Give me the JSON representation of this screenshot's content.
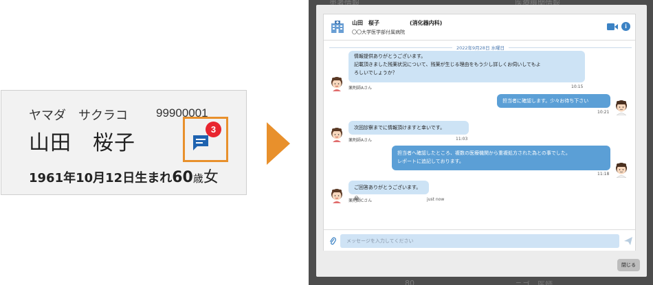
{
  "patient_card": {
    "kana": "ヤマダ　サクラコ",
    "patient_id": "99900001",
    "name": "山田　桜子",
    "dob": "1961年10月12日生まれ",
    "age": "60",
    "age_unit": "歳",
    "sex": "女",
    "unread_count": "3",
    "accent_color": "#e8902c",
    "badge_color": "#e8252f"
  },
  "background": {
    "tab_left": "患者情報",
    "tab_right": "医療機関情報",
    "footer_left": "80",
    "footer_right": "ニゴ　医師"
  },
  "chat": {
    "header": {
      "patient": "山田　桜子",
      "department": "(消化器内科)",
      "hospital": "〇〇大学医学部付属病院"
    },
    "date_separator": "2022年9月28日 水曜日",
    "messages": [
      {
        "dir": "in",
        "lines": [
          "情報提供ありがとうございます。",
          "記載頂きました残薬状況について、残薬が生じる理由をもう少し詳しくお伺いしてもよ",
          "ろしいでしょうか？"
        ],
        "sender": "薬剤師Aさん",
        "time": "10:15"
      },
      {
        "dir": "out",
        "lines": [
          "担当者に確認します。少々お待ち下さい"
        ],
        "time": "10:21"
      },
      {
        "dir": "in",
        "lines": [
          "次回診察までに情報頂けますと幸いです。"
        ],
        "sender": "薬剤師Aさん",
        "time": "11:03"
      },
      {
        "dir": "out",
        "lines": [
          "担当者へ確認したところ、複数の医療機関から重複処方された為との事でした。",
          "レポートに追記しております。"
        ],
        "time": "11:18"
      },
      {
        "dir": "in",
        "lines": [
          "ご回答ありがとうございます。😀"
        ],
        "sender": "薬剤師Cさん",
        "time": "just now"
      }
    ],
    "input_placeholder": "メッセージを入力してください",
    "close_label": "閉じる"
  },
  "colors": {
    "bubble_in": "#cde3f5",
    "bubble_out": "#5b9fd6",
    "arrow": "#e8902c"
  }
}
